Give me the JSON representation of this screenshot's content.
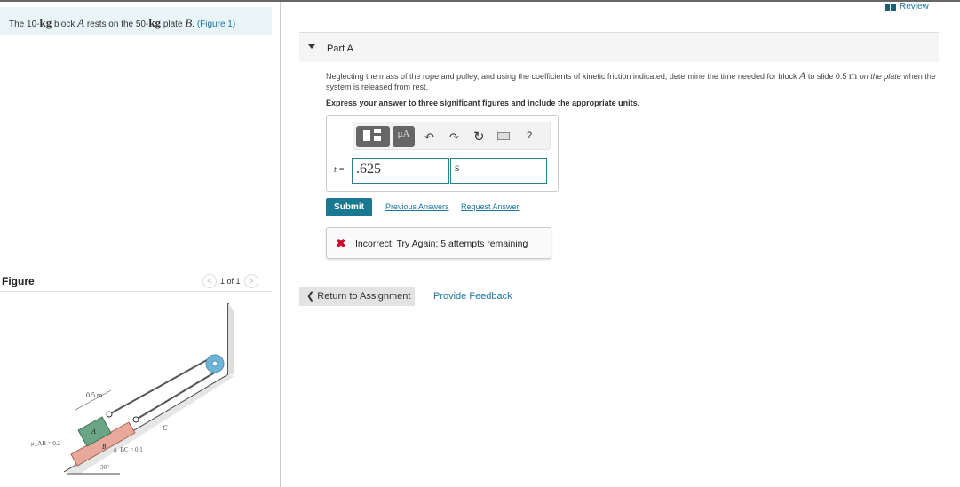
{
  "intro": {
    "t1": "The 10-",
    "unit1": "kg",
    "t2": " block ",
    "blockA": "A",
    "t3": " rests on the 50-",
    "unit2": "kg",
    "t4": " plate ",
    "plateB": "B",
    "t5": ". ",
    "figure_link": "(Figure 1)"
  },
  "figure": {
    "header": "Figure",
    "pager": "1 of 1",
    "labels": {
      "dist": "0.5 m",
      "muAB": "μ_AB = 0.2",
      "muBC": "μ_BC = 0.1",
      "A": "A",
      "B": "B",
      "C": "C",
      "angle": "30°"
    }
  },
  "header": {
    "review": "Review"
  },
  "part": {
    "title": "Part A",
    "q1": "Neglecting the mass of the rope and pulley, and using the coefficients of kinetic friction indicated, determine the time needed for block ",
    "qA": "A",
    "q2": " to slide 0.5 ",
    "qm": "m",
    "q3": " on the plate",
    "q4": " when the system is released from rest.",
    "instruction": "Express your answer to three significant figures and include the appropriate units.",
    "toolbar": {
      "units_btn": "μA",
      "help": "?"
    },
    "variable": "t =",
    "value": ".625",
    "units": "s",
    "submit": "Submit",
    "previous_answers": "Previous Answers",
    "request_answer": "Request Answer",
    "feedback": "Incorrect; Try Again; 5 attempts remaining",
    "status_color": "#c8102e"
  },
  "footer": {
    "return": "Return to Assignment",
    "provide_feedback": "Provide Feedback"
  }
}
